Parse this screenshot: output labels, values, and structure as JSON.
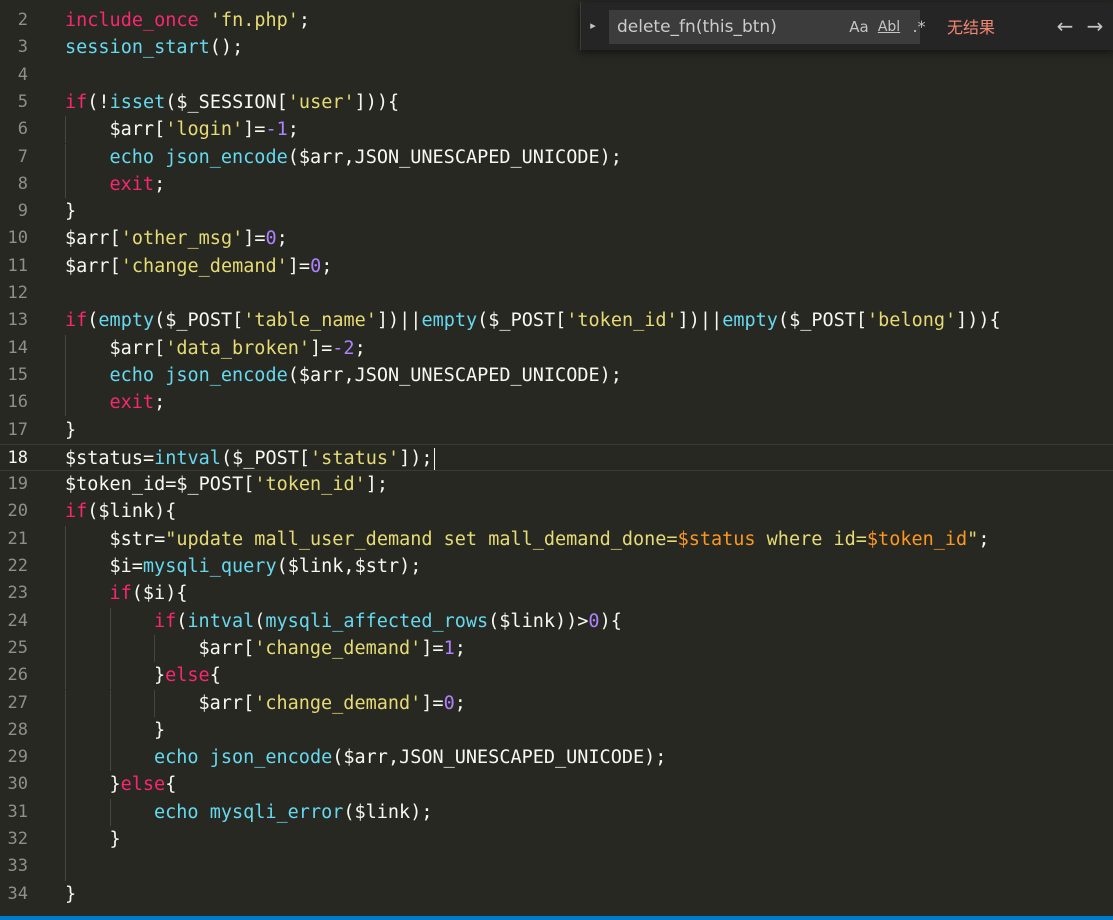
{
  "find": {
    "query": "delete_fn(this_btn)",
    "match_case_label": "Aa",
    "whole_word_label": "Abl",
    "regex_label": ".*",
    "result_text": "无结果",
    "toggle_icon": "chevron-right-icon",
    "prev_icon": "arrow-left-icon",
    "next_icon": "arrow-right-icon"
  },
  "editor": {
    "active_line": 18,
    "lines": [
      {
        "n": "2",
        "indent": 0,
        "tokens": [
          [
            "k",
            "include_once"
          ],
          [
            "p",
            " "
          ],
          [
            "s",
            "'fn.php'"
          ],
          [
            "p",
            ";"
          ]
        ]
      },
      {
        "n": "3",
        "indent": 0,
        "tokens": [
          [
            "f",
            "session_start"
          ],
          [
            "p",
            "();"
          ]
        ]
      },
      {
        "n": "4",
        "indent": 0,
        "tokens": []
      },
      {
        "n": "5",
        "indent": 0,
        "tokens": [
          [
            "k",
            "if"
          ],
          [
            "p",
            "(!"
          ],
          [
            "f",
            "isset"
          ],
          [
            "p",
            "("
          ],
          [
            "v",
            "$_SESSION"
          ],
          [
            "p",
            "["
          ],
          [
            "s",
            "'user'"
          ],
          [
            "p",
            "])){"
          ]
        ]
      },
      {
        "n": "6",
        "indent": 1,
        "tokens": [
          [
            "v",
            "$arr"
          ],
          [
            "p",
            "["
          ],
          [
            "s",
            "'login'"
          ],
          [
            "p",
            "]="
          ],
          [
            "n",
            "-1"
          ],
          [
            "p",
            ";"
          ]
        ]
      },
      {
        "n": "7",
        "indent": 1,
        "tokens": [
          [
            "f",
            "echo"
          ],
          [
            "p",
            " "
          ],
          [
            "f",
            "json_encode"
          ],
          [
            "p",
            "("
          ],
          [
            "v",
            "$arr"
          ],
          [
            "p",
            ",JSON_UNESCAPED_UNICODE);"
          ]
        ]
      },
      {
        "n": "8",
        "indent": 1,
        "tokens": [
          [
            "k",
            "exit"
          ],
          [
            "p",
            ";"
          ]
        ]
      },
      {
        "n": "9",
        "indent": 0,
        "tokens": [
          [
            "p",
            "}"
          ]
        ]
      },
      {
        "n": "10",
        "indent": 0,
        "tokens": [
          [
            "v",
            "$arr"
          ],
          [
            "p",
            "["
          ],
          [
            "s",
            "'other_msg'"
          ],
          [
            "p",
            "]="
          ],
          [
            "n",
            "0"
          ],
          [
            "p",
            ";"
          ]
        ]
      },
      {
        "n": "11",
        "indent": 0,
        "tokens": [
          [
            "v",
            "$arr"
          ],
          [
            "p",
            "["
          ],
          [
            "s",
            "'change_demand'"
          ],
          [
            "p",
            "]="
          ],
          [
            "n",
            "0"
          ],
          [
            "p",
            ";"
          ]
        ]
      },
      {
        "n": "12",
        "indent": 0,
        "tokens": []
      },
      {
        "n": "13",
        "indent": 0,
        "tokens": [
          [
            "k",
            "if"
          ],
          [
            "p",
            "("
          ],
          [
            "f",
            "empty"
          ],
          [
            "p",
            "("
          ],
          [
            "v",
            "$_POST"
          ],
          [
            "p",
            "["
          ],
          [
            "s",
            "'table_name'"
          ],
          [
            "p",
            "])||"
          ],
          [
            "f",
            "empty"
          ],
          [
            "p",
            "("
          ],
          [
            "v",
            "$_POST"
          ],
          [
            "p",
            "["
          ],
          [
            "s",
            "'token_id'"
          ],
          [
            "p",
            "])||"
          ],
          [
            "f",
            "empty"
          ],
          [
            "p",
            "("
          ],
          [
            "v",
            "$_POST"
          ],
          [
            "p",
            "["
          ],
          [
            "s",
            "'belong'"
          ],
          [
            "p",
            "])){"
          ]
        ]
      },
      {
        "n": "14",
        "indent": 1,
        "tokens": [
          [
            "v",
            "$arr"
          ],
          [
            "p",
            "["
          ],
          [
            "s",
            "'data_broken'"
          ],
          [
            "p",
            "]="
          ],
          [
            "n",
            "-2"
          ],
          [
            "p",
            ";"
          ]
        ]
      },
      {
        "n": "15",
        "indent": 1,
        "tokens": [
          [
            "f",
            "echo"
          ],
          [
            "p",
            " "
          ],
          [
            "f",
            "json_encode"
          ],
          [
            "p",
            "("
          ],
          [
            "v",
            "$arr"
          ],
          [
            "p",
            ",JSON_UNESCAPED_UNICODE);"
          ]
        ]
      },
      {
        "n": "16",
        "indent": 1,
        "tokens": [
          [
            "k",
            "exit"
          ],
          [
            "p",
            ";"
          ]
        ]
      },
      {
        "n": "17",
        "indent": 0,
        "tokens": [
          [
            "p",
            "}"
          ]
        ]
      },
      {
        "n": "18",
        "indent": 0,
        "tokens": [
          [
            "v",
            "$status"
          ],
          [
            "p",
            "="
          ],
          [
            "f",
            "intval"
          ],
          [
            "p",
            "("
          ],
          [
            "v",
            "$_POST"
          ],
          [
            "p",
            "["
          ],
          [
            "s",
            "'status'"
          ],
          [
            "p",
            "]);"
          ]
        ]
      },
      {
        "n": "19",
        "indent": 0,
        "tokens": [
          [
            "v",
            "$token_id"
          ],
          [
            "p",
            "="
          ],
          [
            "v",
            "$_POST"
          ],
          [
            "p",
            "["
          ],
          [
            "s",
            "'token_id'"
          ],
          [
            "p",
            "];"
          ]
        ]
      },
      {
        "n": "20",
        "indent": 0,
        "tokens": [
          [
            "k",
            "if"
          ],
          [
            "p",
            "("
          ],
          [
            "v",
            "$link"
          ],
          [
            "p",
            "){"
          ]
        ]
      },
      {
        "n": "21",
        "indent": 1,
        "tokens": [
          [
            "v",
            "$str"
          ],
          [
            "p",
            "="
          ],
          [
            "s",
            "\"update mall_user_demand set mall_demand_done="
          ],
          [
            "sv",
            "$status"
          ],
          [
            "s",
            " where id="
          ],
          [
            "sv",
            "$token_id"
          ],
          [
            "s",
            "\""
          ],
          [
            "p",
            ";"
          ]
        ]
      },
      {
        "n": "22",
        "indent": 1,
        "tokens": [
          [
            "v",
            "$i"
          ],
          [
            "p",
            "="
          ],
          [
            "f",
            "mysqli_query"
          ],
          [
            "p",
            "("
          ],
          [
            "v",
            "$link"
          ],
          [
            "p",
            ","
          ],
          [
            "v",
            "$str"
          ],
          [
            "p",
            ");"
          ]
        ]
      },
      {
        "n": "23",
        "indent": 1,
        "tokens": [
          [
            "k",
            "if"
          ],
          [
            "p",
            "("
          ],
          [
            "v",
            "$i"
          ],
          [
            "p",
            "){"
          ]
        ]
      },
      {
        "n": "24",
        "indent": 2,
        "tokens": [
          [
            "k",
            "if"
          ],
          [
            "p",
            "("
          ],
          [
            "f",
            "intval"
          ],
          [
            "p",
            "("
          ],
          [
            "f",
            "mysqli_affected_rows"
          ],
          [
            "p",
            "("
          ],
          [
            "v",
            "$link"
          ],
          [
            "p",
            "))>"
          ],
          [
            "n",
            "0"
          ],
          [
            "p",
            "){"
          ]
        ]
      },
      {
        "n": "25",
        "indent": 3,
        "tokens": [
          [
            "v",
            "$arr"
          ],
          [
            "p",
            "["
          ],
          [
            "s",
            "'change_demand'"
          ],
          [
            "p",
            "]="
          ],
          [
            "n",
            "1"
          ],
          [
            "p",
            ";"
          ]
        ]
      },
      {
        "n": "26",
        "indent": 2,
        "tokens": [
          [
            "p",
            "}"
          ],
          [
            "k",
            "else"
          ],
          [
            "p",
            "{"
          ]
        ]
      },
      {
        "n": "27",
        "indent": 3,
        "tokens": [
          [
            "v",
            "$arr"
          ],
          [
            "p",
            "["
          ],
          [
            "s",
            "'change_demand'"
          ],
          [
            "p",
            "]="
          ],
          [
            "n",
            "0"
          ],
          [
            "p",
            ";"
          ]
        ]
      },
      {
        "n": "28",
        "indent": 2,
        "tokens": [
          [
            "p",
            "}"
          ]
        ]
      },
      {
        "n": "29",
        "indent": 2,
        "tokens": [
          [
            "f",
            "echo"
          ],
          [
            "p",
            " "
          ],
          [
            "f",
            "json_encode"
          ],
          [
            "p",
            "("
          ],
          [
            "v",
            "$arr"
          ],
          [
            "p",
            ",JSON_UNESCAPED_UNICODE);"
          ]
        ]
      },
      {
        "n": "30",
        "indent": 1,
        "tokens": [
          [
            "p",
            "}"
          ],
          [
            "k",
            "else"
          ],
          [
            "p",
            "{"
          ]
        ]
      },
      {
        "n": "31",
        "indent": 2,
        "tokens": [
          [
            "f",
            "echo"
          ],
          [
            "p",
            " "
          ],
          [
            "f",
            "mysqli_error"
          ],
          [
            "p",
            "("
          ],
          [
            "v",
            "$link"
          ],
          [
            "p",
            ");"
          ]
        ]
      },
      {
        "n": "32",
        "indent": 1,
        "tokens": [
          [
            "p",
            "}"
          ]
        ]
      },
      {
        "n": "33",
        "indent": 1,
        "tokens": []
      },
      {
        "n": "34",
        "indent": 0,
        "tokens": [
          [
            "p",
            "}"
          ]
        ]
      }
    ]
  }
}
